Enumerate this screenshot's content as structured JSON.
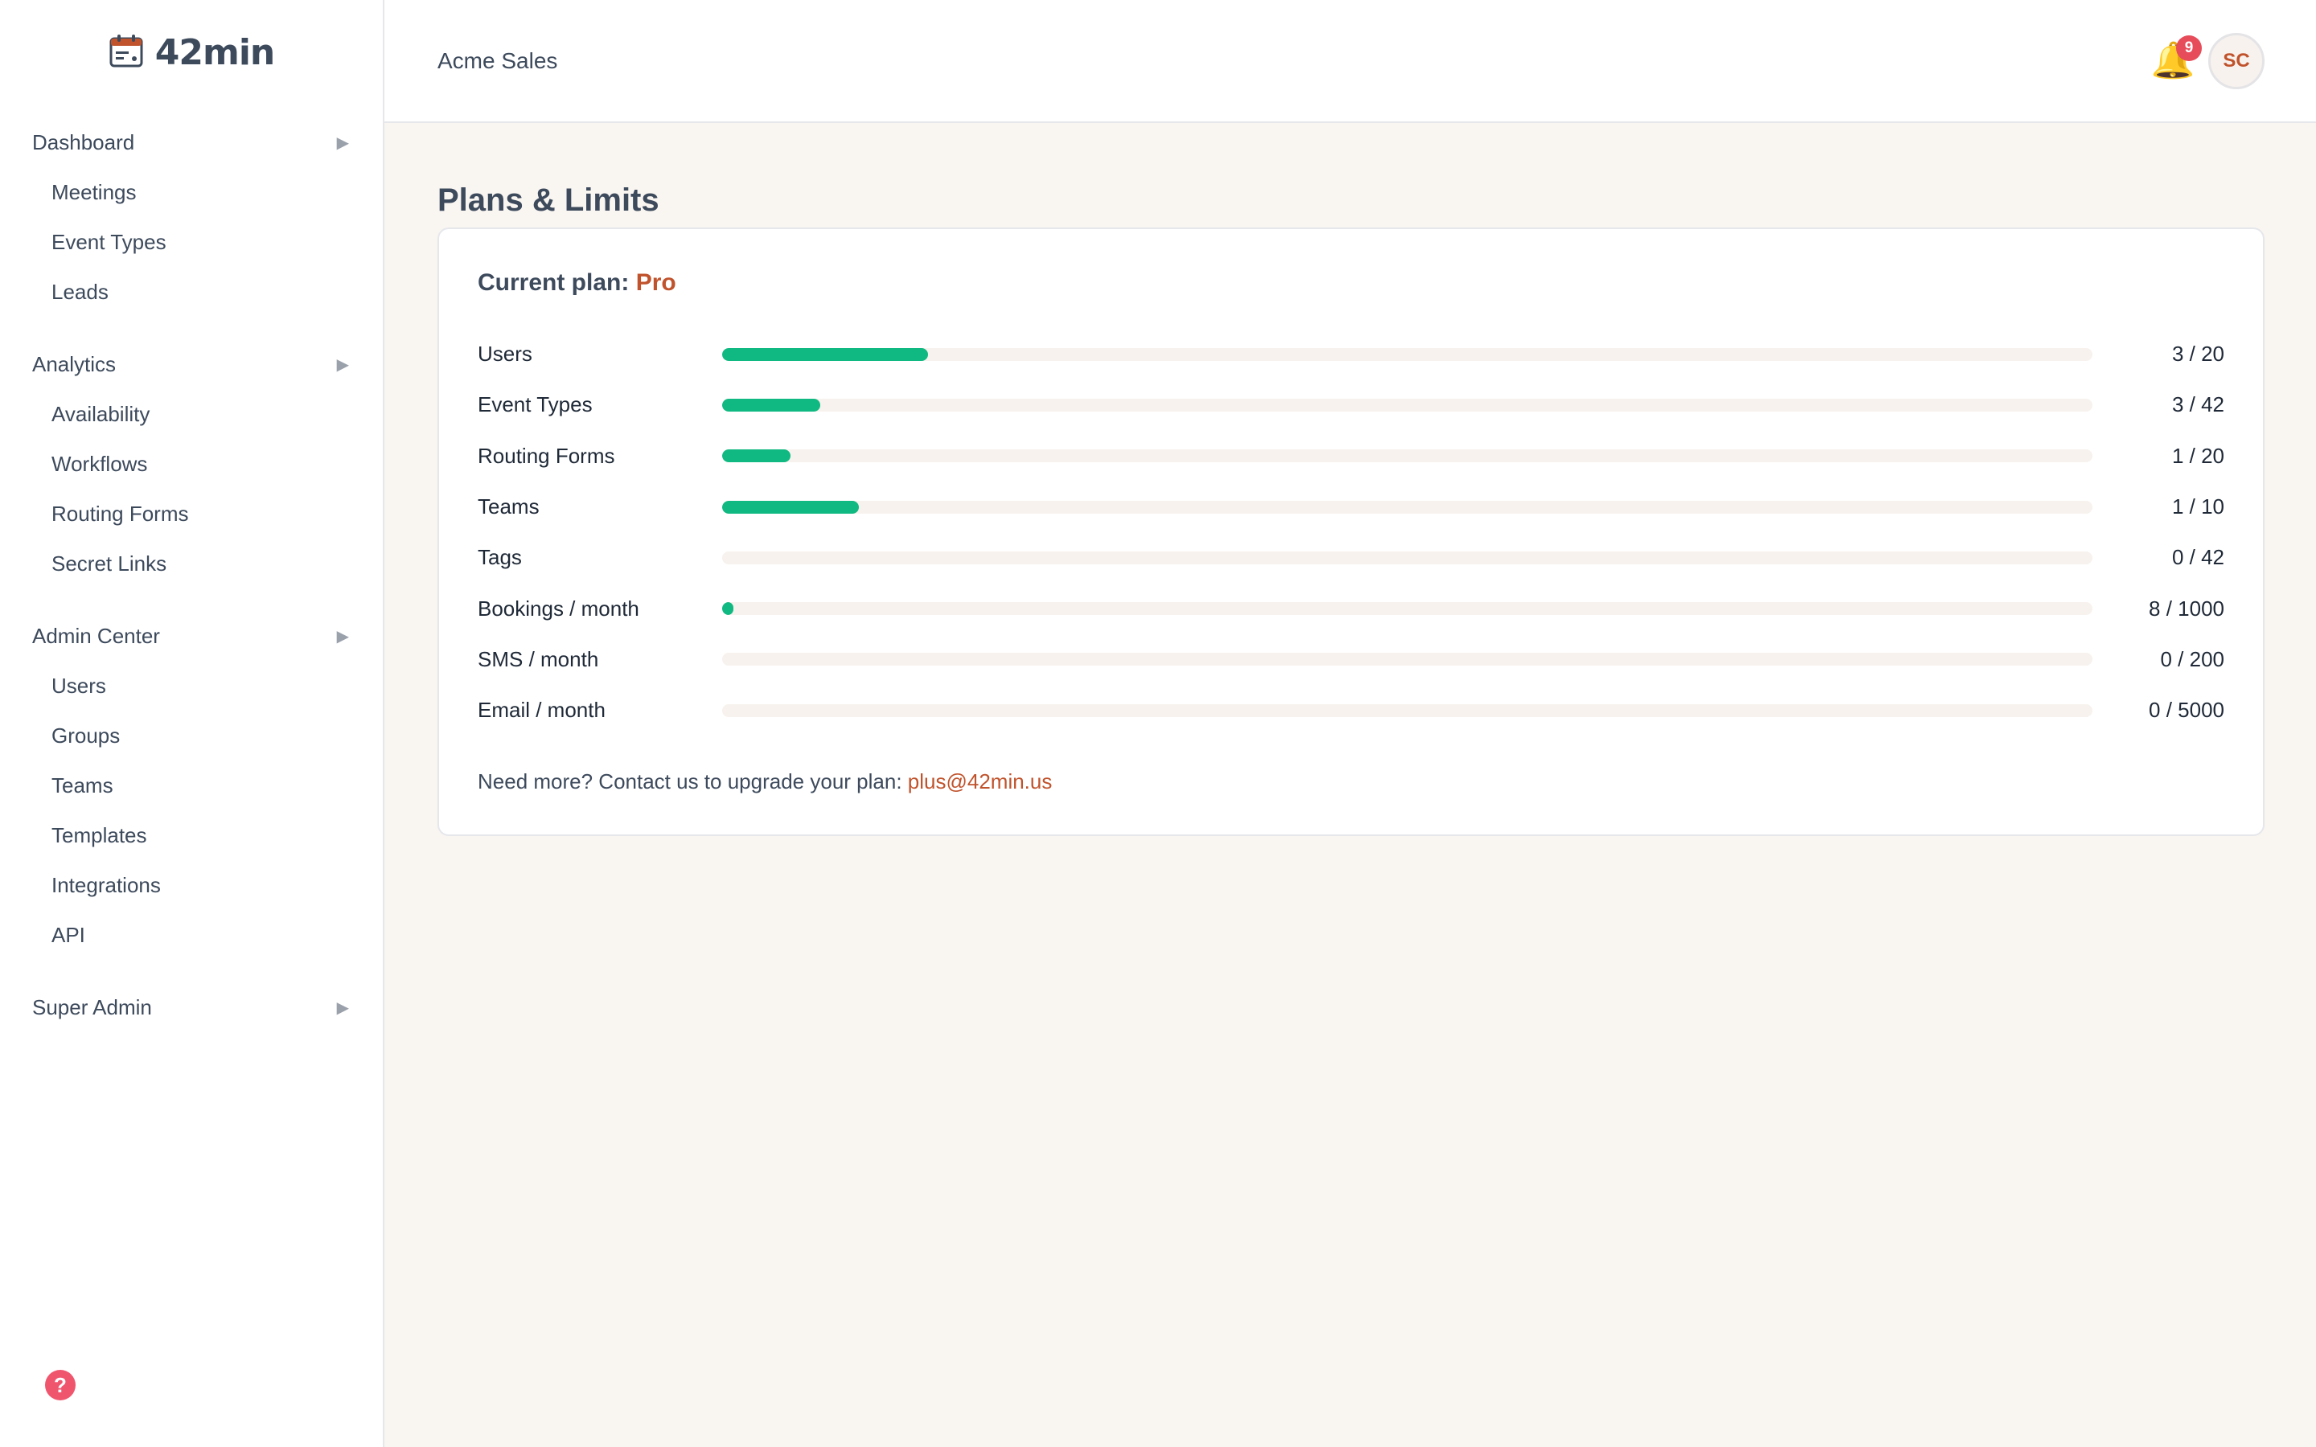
{
  "brand": {
    "name": "42min",
    "icon": "calendar-icon"
  },
  "sidebar": {
    "sections": [
      {
        "label": "Dashboard",
        "items": [
          "Meetings",
          "Event Types",
          "Leads"
        ]
      },
      {
        "label": "Analytics",
        "items": [
          "Availability",
          "Workflows",
          "Routing Forms",
          "Secret Links"
        ]
      },
      {
        "label": "Admin Center",
        "items": [
          "Users",
          "Groups",
          "Teams",
          "Templates",
          "Integrations",
          "API"
        ]
      },
      {
        "label": "Super Admin",
        "items": []
      }
    ],
    "help_icon": "question-icon"
  },
  "header": {
    "org_name": "Acme Sales",
    "notification_count": "9",
    "avatar_initials": "SC"
  },
  "page": {
    "title": "Plans & Limits",
    "plan_prefix": "Current plan:",
    "plan_name": "Pro",
    "limits": [
      {
        "label": "Users",
        "used": 3,
        "max": 20,
        "value": "3 / 20"
      },
      {
        "label": "Event Types",
        "used": 3,
        "max": 42,
        "value": "3 / 42"
      },
      {
        "label": "Routing Forms",
        "used": 1,
        "max": 20,
        "value": "1 / 20"
      },
      {
        "label": "Teams",
        "used": 1,
        "max": 10,
        "value": "1 / 10"
      },
      {
        "label": "Tags",
        "used": 0,
        "max": 42,
        "value": "0 / 42"
      },
      {
        "label": "Bookings / month",
        "used": 8,
        "max": 1000,
        "value": "8 / 1000"
      },
      {
        "label": "SMS / month",
        "used": 0,
        "max": 200,
        "value": "0 / 200"
      },
      {
        "label": "Email / month",
        "used": 0,
        "max": 5000,
        "value": "0 / 5000"
      }
    ],
    "footer_text": "Need more? Contact us to upgrade your plan:",
    "footer_email": "plus@42min.us"
  },
  "colors": {
    "accent": "#c0532c",
    "progress": "#10b981",
    "text": "#3d4a5c",
    "badge": "#e74c5a",
    "help": "#f0556e"
  }
}
